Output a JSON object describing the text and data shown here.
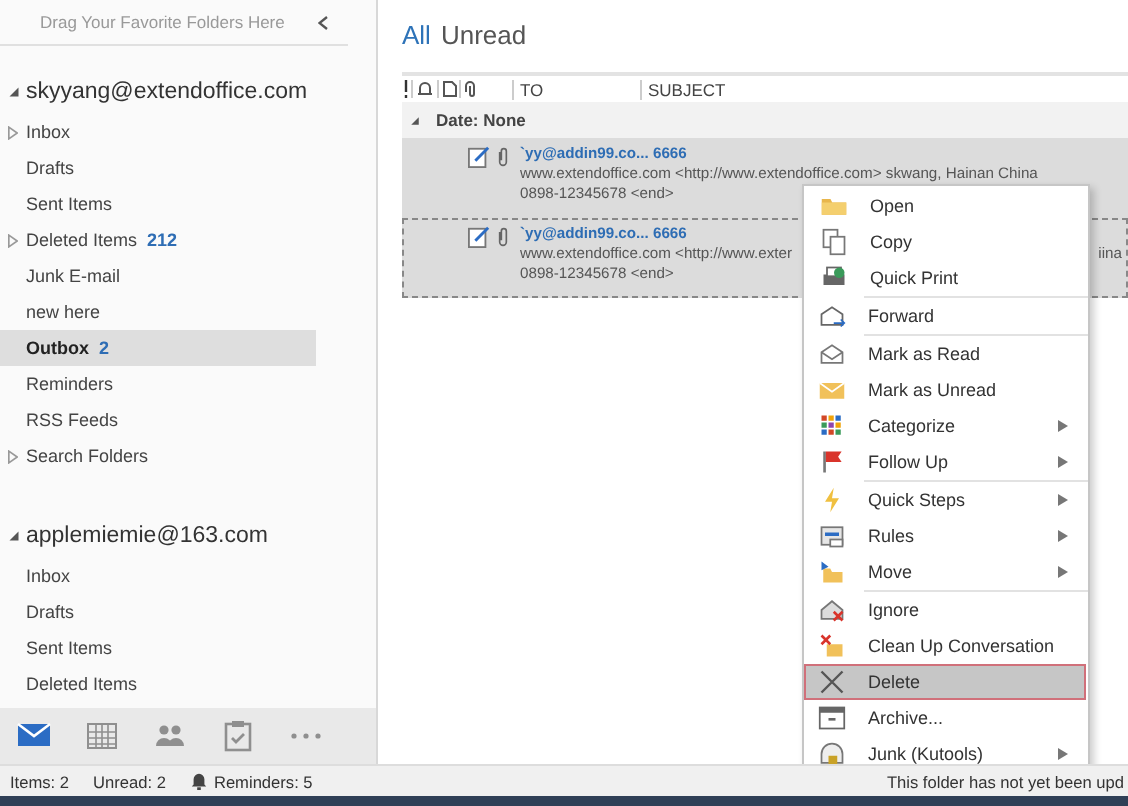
{
  "sidebar": {
    "hint": "Drag Your Favorite Folders Here",
    "accounts": [
      {
        "name": "skyyang@extendoffice.com",
        "expanded": true,
        "folders": [
          {
            "label": "Inbox",
            "expandable": true,
            "selected": false
          },
          {
            "label": "Drafts",
            "expandable": false,
            "selected": false
          },
          {
            "label": "Sent Items",
            "expandable": false,
            "selected": false
          },
          {
            "label": "Deleted Items",
            "count": "212",
            "expandable": true,
            "selected": false
          },
          {
            "label": "Junk E-mail",
            "expandable": false,
            "selected": false
          },
          {
            "label": "new here",
            "expandable": false,
            "selected": false
          },
          {
            "label": "Outbox",
            "count": "2",
            "expandable": false,
            "selected": true
          },
          {
            "label": "Reminders",
            "expandable": false,
            "selected": false
          },
          {
            "label": "RSS Feeds",
            "expandable": false,
            "selected": false
          },
          {
            "label": "Search Folders",
            "expandable": true,
            "selected": false
          }
        ]
      },
      {
        "name": "applemiemie@163.com",
        "expanded": true,
        "folders": [
          {
            "label": "Inbox",
            "expandable": false,
            "selected": false
          },
          {
            "label": "Drafts",
            "expandable": false,
            "selected": false
          },
          {
            "label": "Sent Items",
            "expandable": false,
            "selected": false
          },
          {
            "label": "Deleted Items",
            "expandable": false,
            "selected": false
          }
        ]
      }
    ],
    "nav": [
      {
        "kind": "mail",
        "selected": true
      },
      {
        "kind": "calendar",
        "selected": false
      },
      {
        "kind": "people",
        "selected": false
      },
      {
        "kind": "tasks",
        "selected": false
      },
      {
        "kind": "more",
        "selected": false
      }
    ]
  },
  "filters": [
    {
      "label": "All",
      "selected": true
    },
    {
      "label": "Unread",
      "selected": false
    }
  ],
  "columns": {
    "to": "TO",
    "subject": "SUBJECT"
  },
  "group": {
    "label": "Date: None",
    "expanded": true
  },
  "messages": [
    {
      "title": "`yy@addin99.co... 6666",
      "preview": "www.extendoffice.com <http://www.extendoffice.com>  skwang, Hainan China",
      "line2": "0898-12345678 <end>",
      "selected": true,
      "focused": false
    },
    {
      "title": "`yy@addin99.co... 6666",
      "preview": "www.extendoffice.com <http://www.exter",
      "preview_end": "iina",
      "line2": "0898-12345678 <end>",
      "selected": true,
      "focused": true
    }
  ],
  "context_menu": [
    [
      {
        "label": "Open",
        "submenu": false,
        "selected": false
      },
      {
        "label": "Copy",
        "submenu": false,
        "selected": false
      },
      {
        "label": "Quick Print",
        "submenu": false,
        "selected": false
      }
    ],
    [
      {
        "label": "Forward",
        "submenu": false,
        "selected": false
      }
    ],
    [
      {
        "label": "Mark as Read",
        "submenu": false,
        "selected": false
      },
      {
        "label": "Mark as Unread",
        "submenu": false,
        "selected": false
      },
      {
        "label": "Categorize",
        "submenu": true,
        "selected": false
      },
      {
        "label": "Follow Up",
        "submenu": true,
        "selected": false
      }
    ],
    [
      {
        "label": "Quick Steps",
        "submenu": true,
        "selected": false
      },
      {
        "label": "Rules",
        "submenu": true,
        "selected": false
      },
      {
        "label": "Move",
        "submenu": true,
        "selected": false
      }
    ],
    [
      {
        "label": "Ignore",
        "submenu": false,
        "selected": false
      },
      {
        "label": "Clean Up Conversation",
        "submenu": false,
        "selected": false
      },
      {
        "label": "Delete",
        "submenu": false,
        "selected": true
      },
      {
        "label": "Archive...",
        "submenu": false,
        "selected": false
      },
      {
        "label": "Junk (Kutools)",
        "submenu": true,
        "selected": false
      }
    ]
  ],
  "status_bar": {
    "items": "Items: 2",
    "unread": "Unread: 2",
    "reminders": "Reminders: 5",
    "message": "This folder has not yet been upd"
  }
}
